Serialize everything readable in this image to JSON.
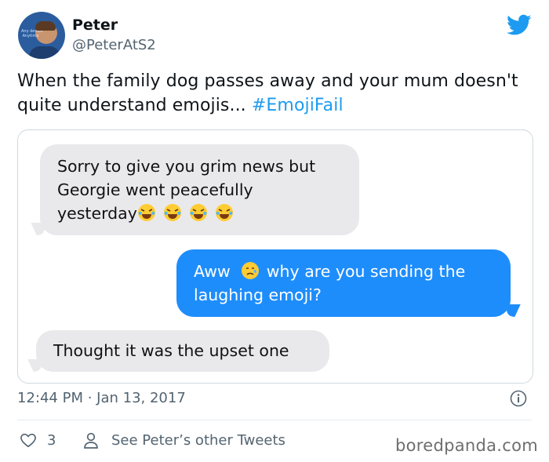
{
  "tweet": {
    "author_name": "Peter",
    "author_handle": "@PeterAtS2",
    "text": "When the family dog passes away and your mum doesn't quite understand emojis... ",
    "hashtag": "#EmojiFail",
    "timestamp": "12:44 PM · Jan 13, 2017",
    "like_count": "3",
    "see_other_label": "See Peter’s other Tweets"
  },
  "conversation": {
    "messages": [
      {
        "sender": "other",
        "text_lines": [
          "Sorry to give you grim news but",
          "Georgie went peacefully",
          "yesterday"
        ],
        "emojis": [
          "laughing-crying-emoji",
          "laughing-crying-emoji",
          "laughing-crying-emoji",
          "laughing-crying-emoji"
        ]
      },
      {
        "sender": "me",
        "text_prefix": "Aww",
        "emoji": "crying-face-emoji",
        "text_suffix": "why are you sending the",
        "text_line2": "laughing emoji?"
      },
      {
        "sender": "other",
        "text": "Thought it was the upset one"
      }
    ]
  },
  "watermark": "boredpanda.com",
  "colors": {
    "twitter_blue": "#1d9bf0",
    "imessage_blue": "#1e8dfc",
    "imessage_gray": "#e9e9eb",
    "muted_text": "#536471"
  },
  "icons": {
    "logo": "twitter-bird-icon",
    "like": "heart-icon",
    "profile": "user-icon",
    "info": "info-icon"
  }
}
